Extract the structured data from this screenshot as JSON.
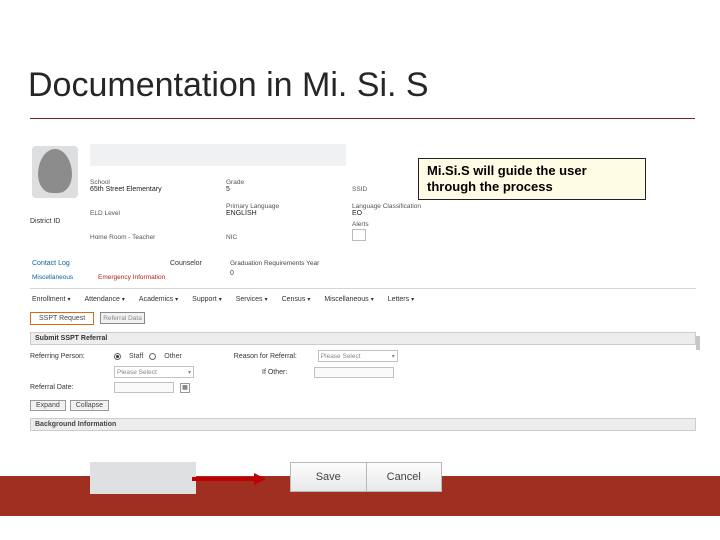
{
  "title": "Documentation in Mi. Si. S",
  "callout": "Mi.Si.S will guide the user through the process",
  "student": {
    "district_id_label": "District ID",
    "school_label": "School",
    "school_value": "65th Street Elementary",
    "eld_label": "ELD Level",
    "eld_value": "",
    "homeroom_label": "Home Room - Teacher",
    "homeroom_value": "",
    "grade_label": "Grade",
    "grade_value": "5",
    "lang_label": "Primary Language",
    "lang_value": "ENGLISH",
    "nic_label": "NIC",
    "nic_value": "",
    "ssid_label": "SSID",
    "ssid_value": "",
    "langclass_label": "Language Classification",
    "langclass_value": "EO",
    "alerts_label": "Alerts",
    "counselor_label": "Counselor",
    "grad_label": "Graduation Requirements Year",
    "grad_value": "0"
  },
  "links": {
    "contact_log": "Contact Log",
    "maintenance": "Miscellaneous",
    "emergency": "Emergency Information"
  },
  "tabs": [
    "Enrollment",
    "Attendance",
    "Academics",
    "Support",
    "Services",
    "Census",
    "Miscellaneous",
    "Letters"
  ],
  "subtabs": {
    "request": "SSPT Request",
    "referral": "Referral Data"
  },
  "form": {
    "header": "Submit SSPT Referral",
    "person_label": "Referring Person:",
    "radio_staff": "Staff",
    "radio_other": "Other",
    "select_placeholder": "Please Select",
    "reason_label": "Reason for Referral:",
    "reason_value": "Please Select",
    "ifother_label": "If Other:",
    "date_label": "Referral Date:",
    "expand": "Expand",
    "collapse": "Collapse",
    "bg_header": "Background Information"
  },
  "actions": {
    "save": "Save",
    "cancel": "Cancel"
  }
}
